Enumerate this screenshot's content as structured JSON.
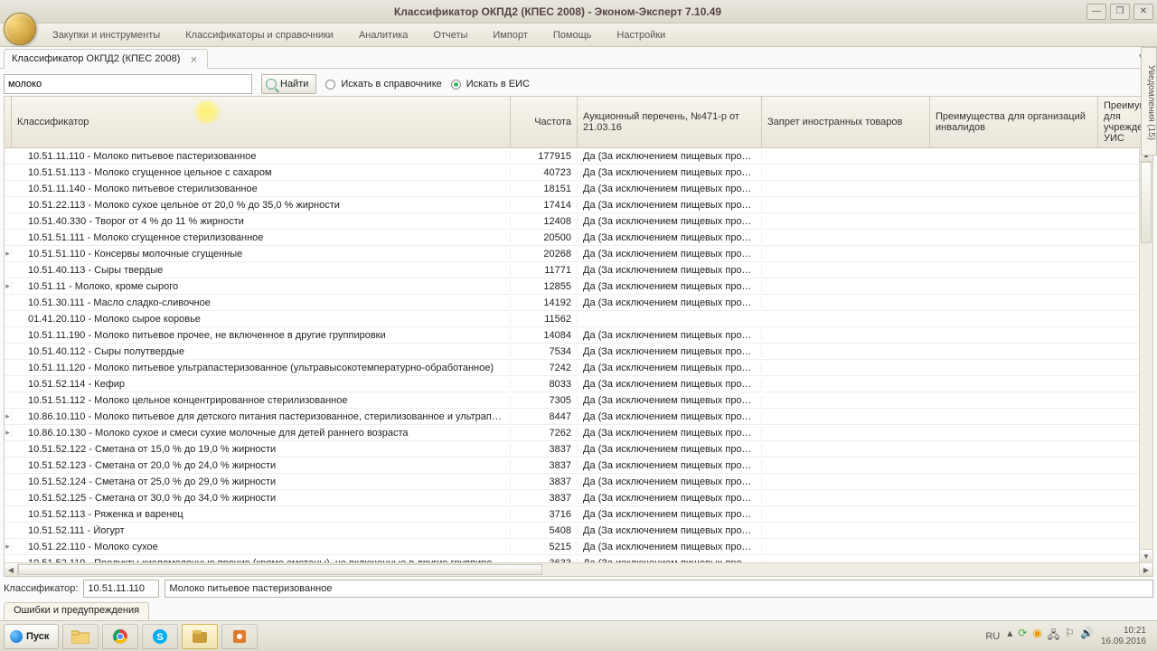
{
  "window": {
    "title": "Классификатор ОКПД2 (КПЕС 2008) - Эконом-Эксперт 7.10.49"
  },
  "menu": {
    "items": [
      "Закупки и инструменты",
      "Классификаторы и справочники",
      "Аналитика",
      "Отчеты",
      "Импорт",
      "Помощь",
      "Настройки"
    ]
  },
  "tab": {
    "label": "Классификатор ОКПД2 (КПЕС 2008)"
  },
  "side_panel": {
    "label": "Уведомления (15)"
  },
  "search": {
    "value": "молоко",
    "find_label": "Найти",
    "radio1": "Искать в справочнике",
    "radio2": "Искать в ЕИС",
    "selected": 2
  },
  "columns": [
    "Классификатор",
    "Частота",
    "Аукционный перечень, №471-р от 21.03.16",
    "Запрет иностранных товаров",
    "Преимущества для организаций инвалидов",
    "Преимущества для учреждений УИС"
  ],
  "rows": [
    {
      "code": "10.51.11.110",
      "name": "Молоко питьевое пастеризованное",
      "freq": "177915",
      "auc": "Да (За исключением пищевых продукт...",
      "exp": false
    },
    {
      "code": "10.51.51.113",
      "name": "Молоко сгущенное цельное с сахаром",
      "freq": "40723",
      "auc": "Да (За исключением пищевых продукт...",
      "exp": false
    },
    {
      "code": "10.51.11.140",
      "name": "Молоко питьевое стерилизованное",
      "freq": "18151",
      "auc": "Да (За исключением пищевых продукт...",
      "exp": false
    },
    {
      "code": "10.51.22.113",
      "name": "Молоко сухое цельное от 20,0 % до 35,0 % жирности",
      "freq": "17414",
      "auc": "Да (За исключением пищевых продукт...",
      "exp": false
    },
    {
      "code": "10.51.40.330",
      "name": "Творог от 4 % до 11 % жирности",
      "freq": "12408",
      "auc": "Да (За исключением пищевых продукт...",
      "exp": false
    },
    {
      "code": "10.51.51.111",
      "name": "Молоко сгущенное стерилизованное",
      "freq": "20500",
      "auc": "Да (За исключением пищевых продукт...",
      "exp": false
    },
    {
      "code": "10.51.51.110",
      "name": "Консервы молочные сгущенные",
      "freq": "20268",
      "auc": "Да (За исключением пищевых продукт...",
      "exp": true
    },
    {
      "code": "10.51.40.113",
      "name": "Сыры твердые",
      "freq": "11771",
      "auc": "Да (За исключением пищевых продукт...",
      "exp": false
    },
    {
      "code": "10.51.11",
      "name": "Молоко, кроме сырого",
      "freq": "12855",
      "auc": "Да (За исключением пищевых продукт...",
      "exp": true
    },
    {
      "code": "10.51.30.111",
      "name": "Масло сладко-сливочное",
      "freq": "14192",
      "auc": "Да (За исключением пищевых продукт...",
      "exp": false
    },
    {
      "code": "01.41.20.110",
      "name": "Молоко сырое коровье",
      "freq": "11562",
      "auc": "",
      "exp": false
    },
    {
      "code": "10.51.11.190",
      "name": "Молоко питьевое прочее, не включенное в другие группировки",
      "freq": "14084",
      "auc": "Да (За исключением пищевых продукт...",
      "exp": false
    },
    {
      "code": "10.51.40.112",
      "name": "Сыры полутвердые",
      "freq": "7534",
      "auc": "Да (За исключением пищевых продукт...",
      "exp": false
    },
    {
      "code": "10.51.11.120",
      "name": "Молоко питьевое ультрапастеризованное (ультравысокотемпературно-обработанное)",
      "freq": "7242",
      "auc": "Да (За исключением пищевых продукт...",
      "exp": false
    },
    {
      "code": "10.51.52.114",
      "name": "Кефир",
      "freq": "8033",
      "auc": "Да (За исключением пищевых продукт...",
      "exp": false
    },
    {
      "code": "10.51.51.112",
      "name": "Молоко цельное концентрированное стерилизованное",
      "freq": "7305",
      "auc": "Да (За исключением пищевых продукт...",
      "exp": false
    },
    {
      "code": "10.86.10.110",
      "name": "Молоко питьевое для детского питания пастеризованное, стерилизованное и ультрапастери...",
      "freq": "8447",
      "auc": "Да (За исключением пищевых продукт...",
      "exp": true
    },
    {
      "code": "10.86.10.130",
      "name": "Молоко сухое и смеси сухие молочные для детей раннего возраста",
      "freq": "7262",
      "auc": "Да (За исключением пищевых продукт...",
      "exp": true
    },
    {
      "code": "10.51.52.122",
      "name": "Сметана от 15,0 % до 19,0 % жирности",
      "freq": "3837",
      "auc": "Да (За исключением пищевых продукт...",
      "exp": false
    },
    {
      "code": "10.51.52.123",
      "name": "Сметана от 20,0 % до 24,0 % жирности",
      "freq": "3837",
      "auc": "Да (За исключением пищевых продукт...",
      "exp": false
    },
    {
      "code": "10.51.52.124",
      "name": "Сметана от 25,0 % до 29,0 % жирности",
      "freq": "3837",
      "auc": "Да (За исключением пищевых продукт...",
      "exp": false
    },
    {
      "code": "10.51.52.125",
      "name": "Сметана от 30,0 % до 34,0 % жирности",
      "freq": "3837",
      "auc": "Да (За исключением пищевых продукт...",
      "exp": false
    },
    {
      "code": "10.51.52.113",
      "name": "Ряженка и варенец",
      "freq": "3716",
      "auc": "Да (За исключением пищевых продукт...",
      "exp": false
    },
    {
      "code": "10.51.52.111",
      "name": "Йогурт",
      "freq": "5408",
      "auc": "Да (За исключением пищевых продукт...",
      "exp": false
    },
    {
      "code": "10.51.22.110",
      "name": "Молоко сухое",
      "freq": "5215",
      "auc": "Да (За исключением пищевых продукт...",
      "exp": true
    },
    {
      "code": "10.51.52.119",
      "name": "Продукты кисломолочные прочие (кроме сметаны), не включенные в другие группировки",
      "freq": "3633",
      "auc": "Да (За исключением пищевых продукт...",
      "exp": false
    }
  ],
  "footer": {
    "label": "Классификатор:",
    "code": "10.51.11.110",
    "name": "Молоко питьевое пастеризованное"
  },
  "errors_tab": "Ошибки и предупреждения",
  "taskbar": {
    "start": "Пуск",
    "lang": "RU",
    "time": "10:21",
    "date": "16.09.2016"
  }
}
